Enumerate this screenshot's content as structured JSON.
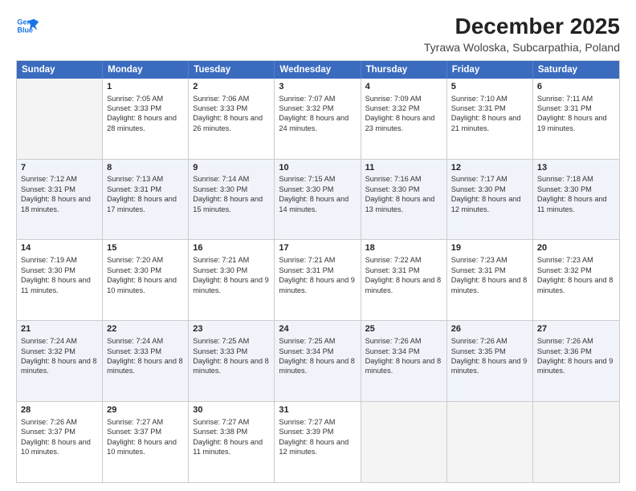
{
  "header": {
    "logo_line1": "General",
    "logo_line2": "Blue",
    "main_title": "December 2025",
    "subtitle": "Tyrawa Woloska, Subcarpathia, Poland"
  },
  "days_of_week": [
    "Sunday",
    "Monday",
    "Tuesday",
    "Wednesday",
    "Thursday",
    "Friday",
    "Saturday"
  ],
  "weeks": [
    [
      {
        "day": "",
        "info": ""
      },
      {
        "day": "1",
        "sunrise": "Sunrise: 7:05 AM",
        "sunset": "Sunset: 3:33 PM",
        "daylight": "Daylight: 8 hours and 28 minutes."
      },
      {
        "day": "2",
        "sunrise": "Sunrise: 7:06 AM",
        "sunset": "Sunset: 3:33 PM",
        "daylight": "Daylight: 8 hours and 26 minutes."
      },
      {
        "day": "3",
        "sunrise": "Sunrise: 7:07 AM",
        "sunset": "Sunset: 3:32 PM",
        "daylight": "Daylight: 8 hours and 24 minutes."
      },
      {
        "day": "4",
        "sunrise": "Sunrise: 7:09 AM",
        "sunset": "Sunset: 3:32 PM",
        "daylight": "Daylight: 8 hours and 23 minutes."
      },
      {
        "day": "5",
        "sunrise": "Sunrise: 7:10 AM",
        "sunset": "Sunset: 3:31 PM",
        "daylight": "Daylight: 8 hours and 21 minutes."
      },
      {
        "day": "6",
        "sunrise": "Sunrise: 7:11 AM",
        "sunset": "Sunset: 3:31 PM",
        "daylight": "Daylight: 8 hours and 19 minutes."
      }
    ],
    [
      {
        "day": "7",
        "sunrise": "Sunrise: 7:12 AM",
        "sunset": "Sunset: 3:31 PM",
        "daylight": "Daylight: 8 hours and 18 minutes."
      },
      {
        "day": "8",
        "sunrise": "Sunrise: 7:13 AM",
        "sunset": "Sunset: 3:31 PM",
        "daylight": "Daylight: 8 hours and 17 minutes."
      },
      {
        "day": "9",
        "sunrise": "Sunrise: 7:14 AM",
        "sunset": "Sunset: 3:30 PM",
        "daylight": "Daylight: 8 hours and 15 minutes."
      },
      {
        "day": "10",
        "sunrise": "Sunrise: 7:15 AM",
        "sunset": "Sunset: 3:30 PM",
        "daylight": "Daylight: 8 hours and 14 minutes."
      },
      {
        "day": "11",
        "sunrise": "Sunrise: 7:16 AM",
        "sunset": "Sunset: 3:30 PM",
        "daylight": "Daylight: 8 hours and 13 minutes."
      },
      {
        "day": "12",
        "sunrise": "Sunrise: 7:17 AM",
        "sunset": "Sunset: 3:30 PM",
        "daylight": "Daylight: 8 hours and 12 minutes."
      },
      {
        "day": "13",
        "sunrise": "Sunrise: 7:18 AM",
        "sunset": "Sunset: 3:30 PM",
        "daylight": "Daylight: 8 hours and 11 minutes."
      }
    ],
    [
      {
        "day": "14",
        "sunrise": "Sunrise: 7:19 AM",
        "sunset": "Sunset: 3:30 PM",
        "daylight": "Daylight: 8 hours and 11 minutes."
      },
      {
        "day": "15",
        "sunrise": "Sunrise: 7:20 AM",
        "sunset": "Sunset: 3:30 PM",
        "daylight": "Daylight: 8 hours and 10 minutes."
      },
      {
        "day": "16",
        "sunrise": "Sunrise: 7:21 AM",
        "sunset": "Sunset: 3:30 PM",
        "daylight": "Daylight: 8 hours and 9 minutes."
      },
      {
        "day": "17",
        "sunrise": "Sunrise: 7:21 AM",
        "sunset": "Sunset: 3:31 PM",
        "daylight": "Daylight: 8 hours and 9 minutes."
      },
      {
        "day": "18",
        "sunrise": "Sunrise: 7:22 AM",
        "sunset": "Sunset: 3:31 PM",
        "daylight": "Daylight: 8 hours and 8 minutes."
      },
      {
        "day": "19",
        "sunrise": "Sunrise: 7:23 AM",
        "sunset": "Sunset: 3:31 PM",
        "daylight": "Daylight: 8 hours and 8 minutes."
      },
      {
        "day": "20",
        "sunrise": "Sunrise: 7:23 AM",
        "sunset": "Sunset: 3:32 PM",
        "daylight": "Daylight: 8 hours and 8 minutes."
      }
    ],
    [
      {
        "day": "21",
        "sunrise": "Sunrise: 7:24 AM",
        "sunset": "Sunset: 3:32 PM",
        "daylight": "Daylight: 8 hours and 8 minutes."
      },
      {
        "day": "22",
        "sunrise": "Sunrise: 7:24 AM",
        "sunset": "Sunset: 3:33 PM",
        "daylight": "Daylight: 8 hours and 8 minutes."
      },
      {
        "day": "23",
        "sunrise": "Sunrise: 7:25 AM",
        "sunset": "Sunset: 3:33 PM",
        "daylight": "Daylight: 8 hours and 8 minutes."
      },
      {
        "day": "24",
        "sunrise": "Sunrise: 7:25 AM",
        "sunset": "Sunset: 3:34 PM",
        "daylight": "Daylight: 8 hours and 8 minutes."
      },
      {
        "day": "25",
        "sunrise": "Sunrise: 7:26 AM",
        "sunset": "Sunset: 3:34 PM",
        "daylight": "Daylight: 8 hours and 8 minutes."
      },
      {
        "day": "26",
        "sunrise": "Sunrise: 7:26 AM",
        "sunset": "Sunset: 3:35 PM",
        "daylight": "Daylight: 8 hours and 9 minutes."
      },
      {
        "day": "27",
        "sunrise": "Sunrise: 7:26 AM",
        "sunset": "Sunset: 3:36 PM",
        "daylight": "Daylight: 8 hours and 9 minutes."
      }
    ],
    [
      {
        "day": "28",
        "sunrise": "Sunrise: 7:26 AM",
        "sunset": "Sunset: 3:37 PM",
        "daylight": "Daylight: 8 hours and 10 minutes."
      },
      {
        "day": "29",
        "sunrise": "Sunrise: 7:27 AM",
        "sunset": "Sunset: 3:37 PM",
        "daylight": "Daylight: 8 hours and 10 minutes."
      },
      {
        "day": "30",
        "sunrise": "Sunrise: 7:27 AM",
        "sunset": "Sunset: 3:38 PM",
        "daylight": "Daylight: 8 hours and 11 minutes."
      },
      {
        "day": "31",
        "sunrise": "Sunrise: 7:27 AM",
        "sunset": "Sunset: 3:39 PM",
        "daylight": "Daylight: 8 hours and 12 minutes."
      },
      {
        "day": "",
        "info": ""
      },
      {
        "day": "",
        "info": ""
      },
      {
        "day": "",
        "info": ""
      }
    ]
  ]
}
